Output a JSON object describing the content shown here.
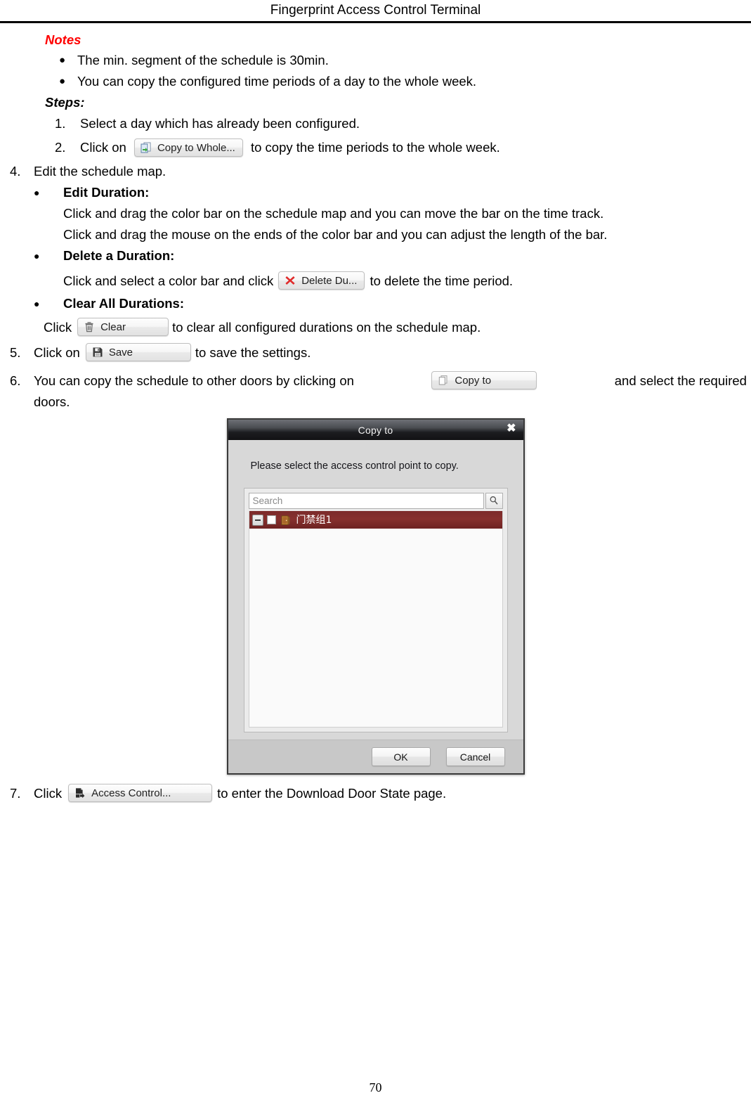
{
  "header": {
    "title": "Fingerprint Access Control Terminal"
  },
  "notes": {
    "heading": "Notes",
    "items": [
      "The min. segment of the schedule is 30min.",
      "You can copy the configured time periods of a day to the whole week."
    ]
  },
  "steps": {
    "heading": "Steps:",
    "sub_items": [
      {
        "num": "1.",
        "text": "Select a day which has already been configured."
      },
      {
        "num": "2.",
        "prefix": "Click on",
        "button": "Copy to Whole...",
        "suffix": "to copy the time periods to the whole week."
      }
    ]
  },
  "step4": {
    "num": "4.",
    "text": "Edit the schedule map.",
    "bullets": [
      {
        "title": "Edit Duration:",
        "lines": [
          "Click and drag the color bar on the schedule map and you can move the bar on the time track.",
          "Click and drag the mouse on the ends of the color bar and you can adjust the length of the bar."
        ]
      },
      {
        "title": "Delete a Duration:",
        "prefix": "Click and select a color bar and click",
        "button": "Delete Du...",
        "suffix": "to delete the time period."
      },
      {
        "title": "Clear All Durations:",
        "prefix": "Click",
        "button": "Clear",
        "suffix": "to clear all configured durations on the schedule map."
      }
    ]
  },
  "step5": {
    "num": "5.",
    "prefix": "Click on",
    "button": "Save",
    "suffix": "to save the settings."
  },
  "step6": {
    "num": "6.",
    "prefix": "You  can  copy  the  schedule  to  other  doors  by  clicking  on",
    "button": "Copy to",
    "suffix": "and  select  the  required",
    "line2": "doors."
  },
  "step7": {
    "num": "7.",
    "prefix": "Click",
    "button": "Access Control...",
    "suffix": "to enter the Download Door State page."
  },
  "dialog": {
    "title": "Copy to",
    "close_label": "✖",
    "prompt": "Please select the access control point to copy.",
    "search_placeholder": "Search",
    "tree": {
      "node_label": "门禁组1"
    },
    "ok_label": "OK",
    "cancel_label": "Cancel"
  },
  "footer": {
    "page_number": "70"
  },
  "icons": {
    "copy_to_whole": "copy-documents-green-arrow-icon",
    "delete_duration": "red-x-icon",
    "clear": "trash-can-icon",
    "save": "floppy-disk-icon",
    "copy_to": "copy-documents-icon",
    "access_control": "document-export-arrow-icon",
    "search": "magnifier-icon",
    "door": "door-icon",
    "close": "close-icon"
  },
  "colors": {
    "notes_red": "#FF0000",
    "tree_selected": "#7b2b2b",
    "titlebar_dark": "#1c1d20",
    "door_orange": "#d98a2b"
  }
}
